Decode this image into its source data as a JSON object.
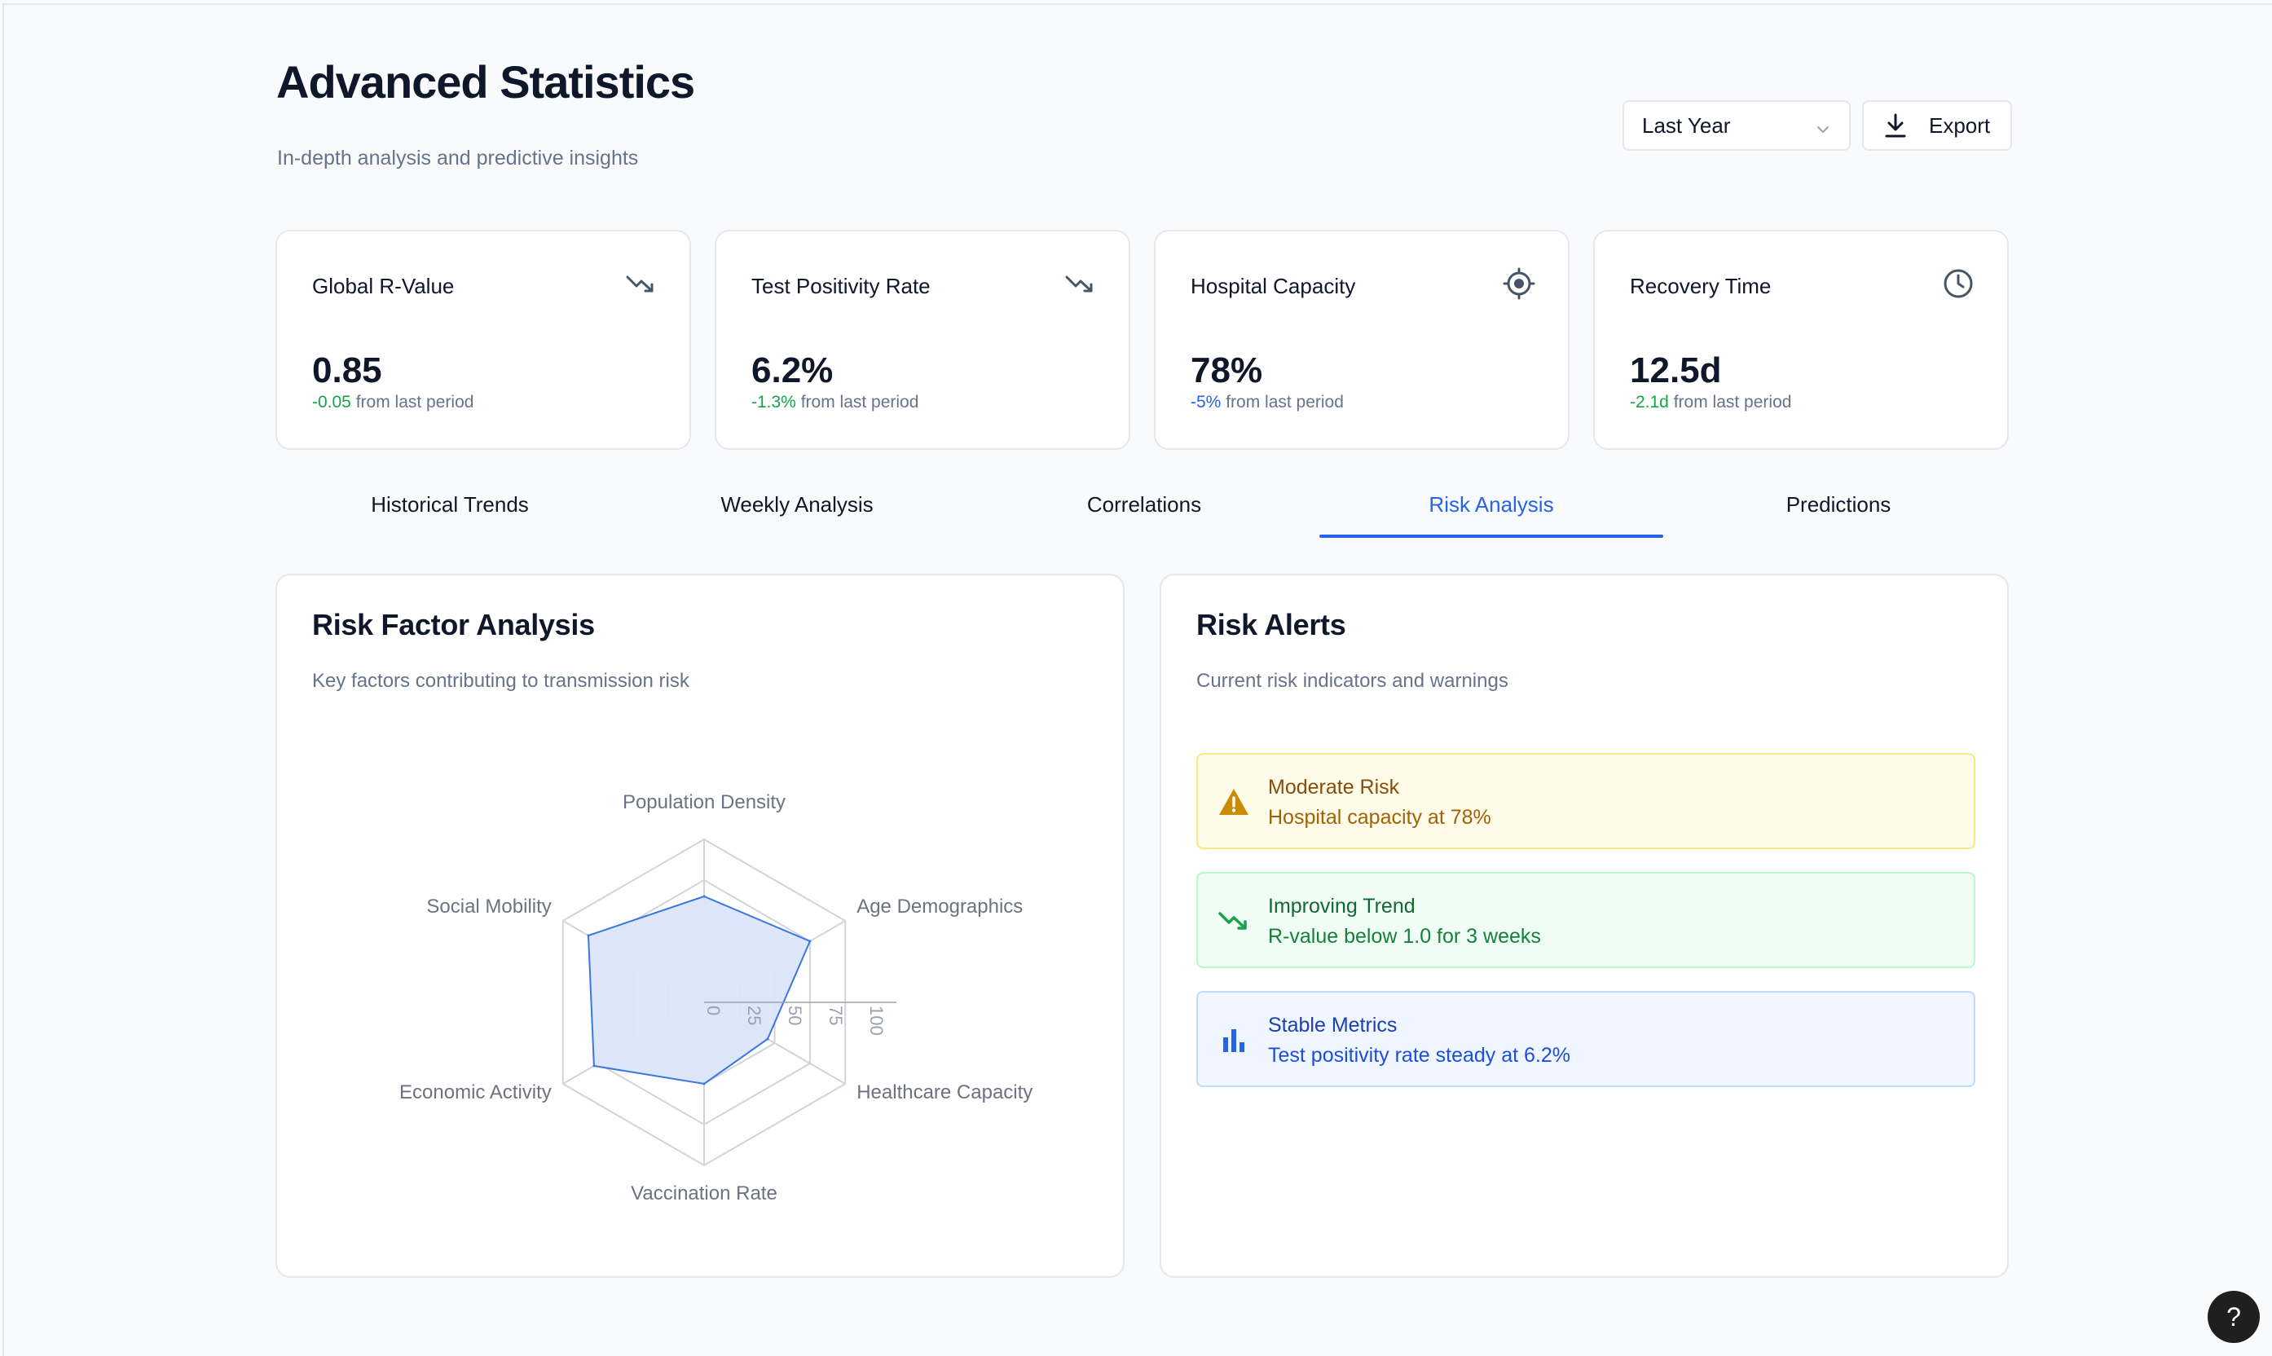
{
  "header": {
    "title": "Advanced Statistics",
    "subtitle": "In-depth analysis and predictive insights",
    "period_select": "Last Year",
    "export_label": "Export"
  },
  "stats": [
    {
      "label": "Global R-Value",
      "value": "0.85",
      "change": "-0.05",
      "suffix": " from last period",
      "icon": "trending-down-icon"
    },
    {
      "label": "Test Positivity Rate",
      "value": "6.2%",
      "change": "-1.3%",
      "suffix": " from last period",
      "icon": "trending-down-icon"
    },
    {
      "label": "Hospital Capacity",
      "value": "78%",
      "change": "-5%",
      "suffix": " from last period",
      "icon": "target-icon"
    },
    {
      "label": "Recovery Time",
      "value": "12.5d",
      "change": "-2.1d",
      "suffix": " from last period",
      "icon": "clock-icon"
    }
  ],
  "tabs": [
    {
      "label": "Historical Trends"
    },
    {
      "label": "Weekly Analysis"
    },
    {
      "label": "Correlations"
    },
    {
      "label": "Risk Analysis",
      "active": true
    },
    {
      "label": "Predictions"
    }
  ],
  "risk_factor": {
    "title": "Risk Factor Analysis",
    "subtitle": "Key factors contributing to transmission risk"
  },
  "risk_alerts": {
    "title": "Risk Alerts",
    "subtitle": "Current risk indicators and warnings",
    "alerts": [
      {
        "title": "Moderate Risk",
        "text": "Hospital capacity at 78%",
        "icon": "warning-icon"
      },
      {
        "title": "Improving Trend",
        "text": "R-value below 1.0 for 3 weeks",
        "icon": "trending-down-icon"
      },
      {
        "title": "Stable Metrics",
        "text": "Test positivity rate steady at 6.2%",
        "icon": "bar-chart-icon"
      }
    ]
  },
  "help_label": "?",
  "colors": {
    "accent": "#2563eb",
    "positive": "#16a34a",
    "radar_fill": "#dbe5fb",
    "radar_stroke": "#3b76e1"
  },
  "chart_data": {
    "type": "radar",
    "categories": [
      "Population Density",
      "Age Demographics",
      "Healthcare Capacity",
      "Vaccination Rate",
      "Economic Activity",
      "Social Mobility"
    ],
    "values": [
      65,
      75,
      45,
      50,
      78,
      82
    ],
    "radial_ticks": [
      "0",
      "25",
      "50",
      "75",
      "100"
    ],
    "rlim": [
      0,
      100
    ]
  }
}
